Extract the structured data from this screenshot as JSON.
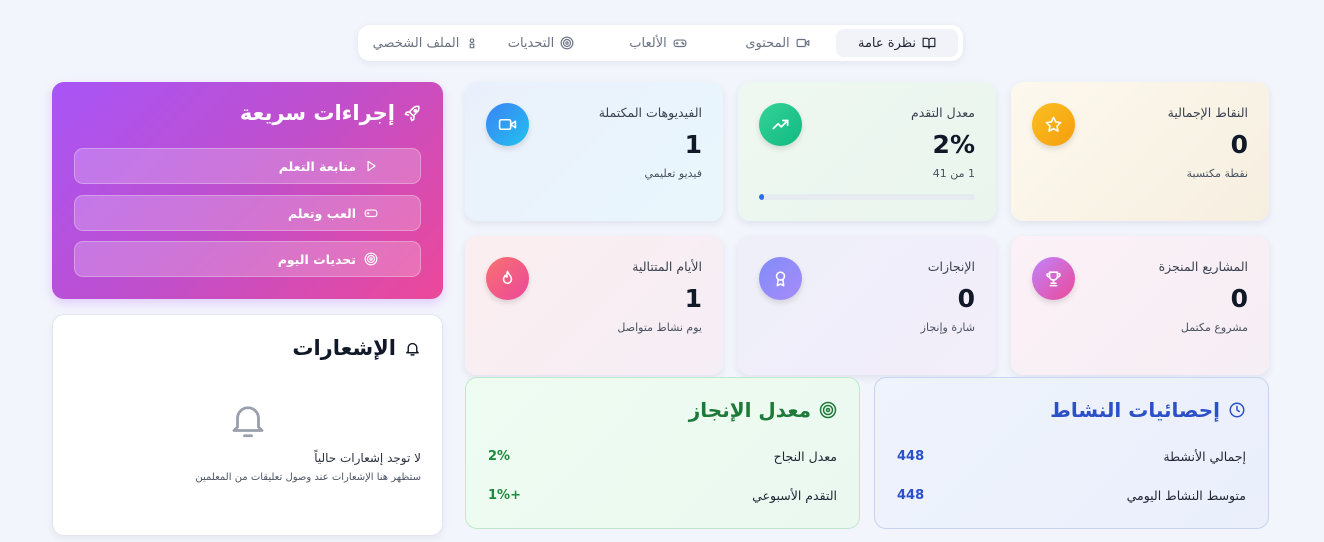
{
  "tabs": [
    {
      "label": "نظرة عامة",
      "icon": "book-open-icon",
      "active": true
    },
    {
      "label": "المحتوى",
      "icon": "video-icon",
      "active": false
    },
    {
      "label": "الألعاب",
      "icon": "gamepad-icon",
      "active": false
    },
    {
      "label": "التحديات",
      "icon": "target-icon",
      "active": false
    },
    {
      "label": "الملف الشخصي",
      "icon": "user-icon",
      "active": false
    }
  ],
  "stats": {
    "points": {
      "label": "النقاط الإجمالية",
      "value": "0",
      "sub": "نقطة مكتسبة",
      "icon": "star-icon"
    },
    "progress": {
      "label": "معدل التقدم",
      "value": "2%",
      "sub": "1 من 41",
      "icon": "trending-up-icon",
      "progress_fraction": 0.024
    },
    "videos": {
      "label": "الفيديوهات المكتملة",
      "value": "1",
      "sub": "فيديو تعليمي",
      "icon": "video-icon"
    },
    "projects": {
      "label": "المشاريع المنجزة",
      "value": "0",
      "sub": "مشروع مكتمل",
      "icon": "trophy-icon"
    },
    "achievements": {
      "label": "الإنجازات",
      "value": "0",
      "sub": "شارة وإنجاز",
      "icon": "award-icon"
    },
    "streak": {
      "label": "الأيام المتتالية",
      "value": "1",
      "sub": "يوم نشاط متواصل",
      "icon": "flame-icon"
    }
  },
  "quick_actions": {
    "title": "إجراءات سريعة",
    "icon": "rocket-icon",
    "items": [
      {
        "label": "متابعة التعلم",
        "icon": "play-icon"
      },
      {
        "label": "العب وتعلم",
        "icon": "gamepad-icon"
      },
      {
        "label": "تحديات اليوم",
        "icon": "target-icon"
      }
    ]
  },
  "notifications": {
    "title": "الإشعارات",
    "icon": "bell-icon",
    "empty_title": "لا توجد إشعارات حالياً",
    "empty_desc": "ستظهر هنا الإشعارات عند وصول تعليقات من المعلمين"
  },
  "activity": {
    "title": "إحصائيات النشاط",
    "icon": "clock-icon",
    "rows": [
      {
        "label": "إجمالي الأنشطة",
        "value": "448"
      },
      {
        "label": "متوسط النشاط اليومي",
        "value": "448"
      }
    ]
  },
  "completion": {
    "title": "معدل الإنجاز",
    "icon": "target-icon",
    "rows": [
      {
        "label": "معدل النجاح",
        "value": "2%"
      },
      {
        "label": "التقدم الأسبوعي",
        "value": "+1%"
      }
    ]
  },
  "colors": {
    "activity_accent": "#2b50c8",
    "completion_accent": "#1e8a3e",
    "progress_fill": "#2f6bf0"
  }
}
